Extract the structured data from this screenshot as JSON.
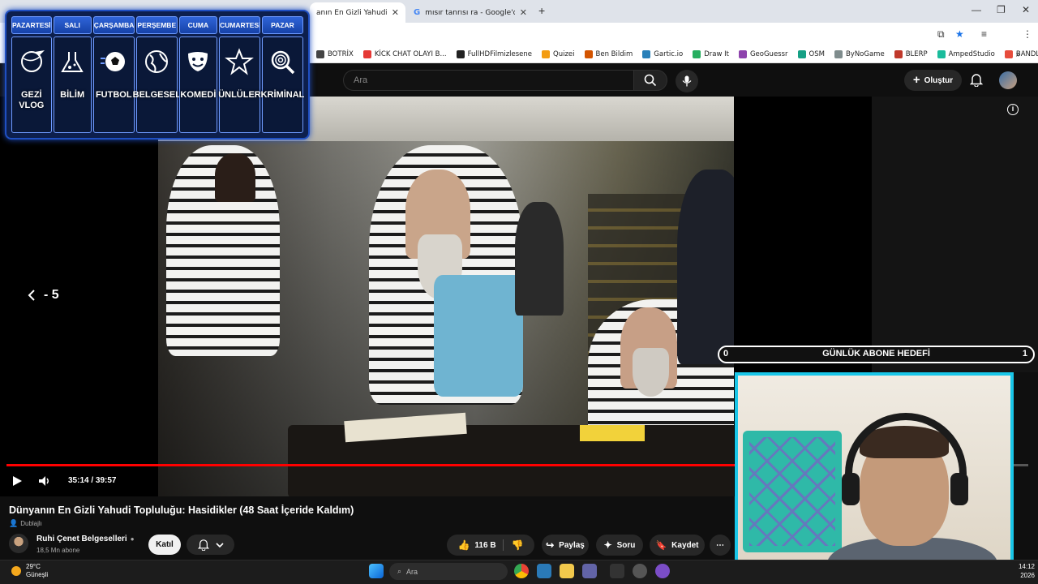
{
  "browser": {
    "tabs": [
      {
        "label": "anın En Gizli Yahudi Toplul",
        "active": true
      },
      {
        "label": "mısır tanrısı ra - Google'da Ara",
        "active": false
      }
    ],
    "bookmarks": [
      {
        "label": "BOTRİX",
        "color": "#444444"
      },
      {
        "label": "KİCK CHAT OLAYI B...",
        "color": "#e53935"
      },
      {
        "label": "FullHDFilmizlesene",
        "color": "#222222"
      },
      {
        "label": "Quizei",
        "color": "#f39c12"
      },
      {
        "label": "Ben Bildim",
        "color": "#d35400"
      },
      {
        "label": "Gartic.io",
        "color": "#2980b9"
      },
      {
        "label": "Draw It",
        "color": "#27ae60"
      },
      {
        "label": "GeoGuessr",
        "color": "#8e44ad"
      },
      {
        "label": "OSM",
        "color": "#16a085"
      },
      {
        "label": "ByNoGame",
        "color": "#7f8c8d"
      },
      {
        "label": "BLERP",
        "color": "#c0392b"
      },
      {
        "label": "AmpedStudio",
        "color": "#1abc9c"
      },
      {
        "label": "BANDLAB",
        "color": "#e74c3c"
      }
    ]
  },
  "youtube": {
    "search_placeholder": "Ara",
    "create_label": "Oluştur",
    "info_icon": "i",
    "seek_back_label": "- 5",
    "progress": 0.889,
    "time": "35:14 / 39:57",
    "title": "Dünyanın En Gizli Yahudi Topluluğu: Hasidikler (48 Saat İçeride Kaldım)",
    "dub_label": "Dublajlı",
    "channel_name": "Ruhi Çenet Belgeselleri",
    "channel_subs": "18,5 Mn abone",
    "join_label": "Katıl",
    "like_count": "116 B",
    "share_label": "Paylaş",
    "ask_label": "Soru",
    "save_label": "Kaydet"
  },
  "schedule": [
    {
      "day": "PAZARTESİ",
      "label": "GEZİ VLOG",
      "icon": "globe-plane-icon"
    },
    {
      "day": "SALI",
      "label": "BİLİM",
      "icon": "science-icon"
    },
    {
      "day": "ÇARŞAMBA",
      "label": "FUTBOL",
      "icon": "soccer-ball-icon"
    },
    {
      "day": "PERŞEMBE",
      "label": "BELGESEL",
      "icon": "earth-icon"
    },
    {
      "day": "CUMA",
      "label": "KOMEDİ",
      "icon": "theater-mask-icon"
    },
    {
      "day": "CUMARTESİ",
      "label": "ÜNLÜLER",
      "icon": "star-icon"
    },
    {
      "day": "PAZAR",
      "label": "KRİMİNAL",
      "icon": "fingerprint-icon"
    }
  ],
  "sub_goal": {
    "min": "0",
    "label": "GÜNLÜK ABONE HEDEFİ",
    "max": "1"
  },
  "taskbar": {
    "temp": "29°C",
    "weather": "Güneşli",
    "search_placeholder": "Ara",
    "time": "14:12",
    "year": "2026"
  },
  "colors": {
    "accent": "#ff0000",
    "overlay_blue": "#1f4fc2",
    "webcam_border": "#19c6e8"
  }
}
